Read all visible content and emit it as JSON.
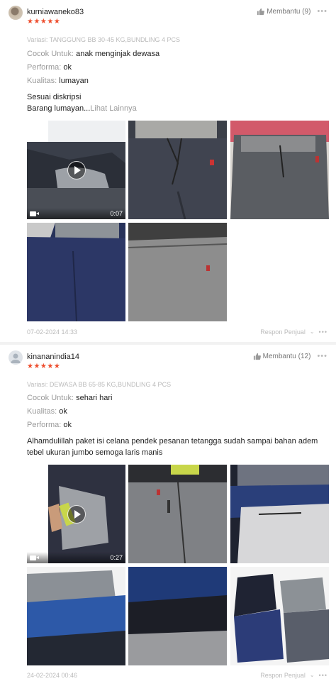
{
  "reviews": [
    {
      "username": "kurniawaneko83",
      "stars": "★★★★★",
      "helpful_label": "Membantu (9)",
      "variant": "Variasi: TANGGUNG BB 30-45 KG,BUNDLING 4 PCS",
      "attrs": [
        {
          "key": "Cocok Untuk:",
          "value": "anak menginjak dewasa"
        },
        {
          "key": "Performa:",
          "value": "ok"
        },
        {
          "key": "Kualitas:",
          "value": "lumayan"
        }
      ],
      "comment_line1": "Sesuai diskripsi",
      "comment_line2": "Barang lumayan...",
      "see_more": "Lihat Lainnya",
      "video_duration": "0:07",
      "date": "07-02-2024 14:33",
      "reply_label": "Respon Penjual"
    },
    {
      "username": "kinananindia14",
      "stars": "★★★★★",
      "helpful_label": "Membantu (12)",
      "variant": "Variasi: DEWASA BB 65-85 KG,BUNDLING 4 PCS",
      "attrs": [
        {
          "key": "Cocok Untuk:",
          "value": "sehari hari"
        },
        {
          "key": "Kualitas:",
          "value": "ok"
        },
        {
          "key": "Performa:",
          "value": "ok"
        }
      ],
      "comment_line1": "Alhamdulillah paket isi celana pendek pesanan tetangga sudah sampai bahan adem",
      "comment_line2": "tebel ukuran jumbo semoga laris manis",
      "video_duration": "0:27",
      "date": "24-02-2024 00:46",
      "reply_label": "Respon Penjual"
    }
  ],
  "icons": {
    "thumb": "thumbs-up-icon",
    "more": "more-dots-icon",
    "play": "play-icon",
    "camera": "video-camera-icon",
    "chevron": "chevron-down-icon"
  },
  "colors": {
    "star": "#ee4d2d",
    "muted": "#bbbbbb",
    "label": "#999999"
  }
}
